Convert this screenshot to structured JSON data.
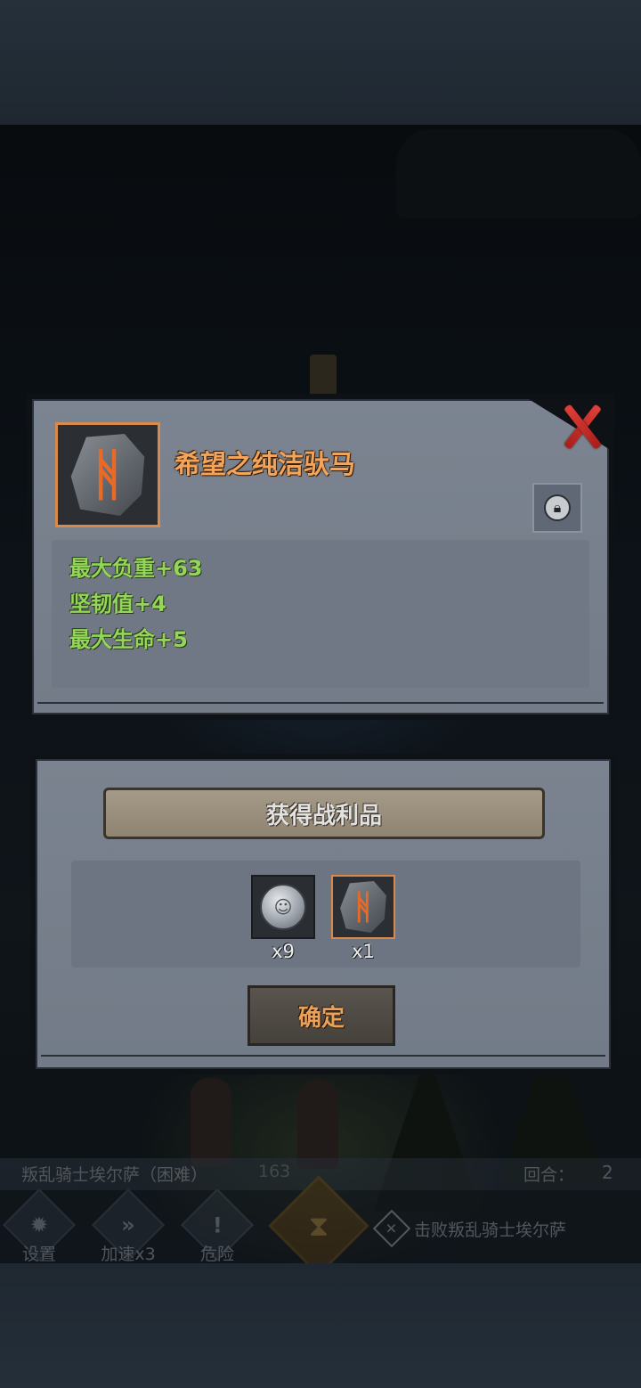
{
  "item_panel": {
    "title": "希望之纯洁驮马",
    "icon": "rune-stone-icon",
    "stats": [
      "最大负重+63",
      "坚韧值+4",
      "最大生命+5"
    ]
  },
  "reward_panel": {
    "header": "获得战利品",
    "items": [
      {
        "icon": "silver-coin-icon",
        "count": "x9"
      },
      {
        "icon": "rune-stone-icon",
        "count": "x1"
      }
    ],
    "confirm_label": "确定"
  },
  "hud": {
    "boss_name": "叛乱骑士埃尔萨（困难）",
    "boss_number": "163",
    "round_label": "回合：",
    "round_value": "2",
    "buttons": [
      {
        "label": "设置",
        "icon": "gear-icon"
      },
      {
        "label": "加速x3",
        "icon": "fast-forward-icon"
      },
      {
        "label": "危险",
        "icon": "exclamation-icon"
      }
    ],
    "goal_text": "击败叛乱骑士埃尔萨"
  },
  "colors": {
    "accent_orange": "#e8a25c",
    "stat_green": "#93d65a",
    "close_red": "#e0403a"
  }
}
